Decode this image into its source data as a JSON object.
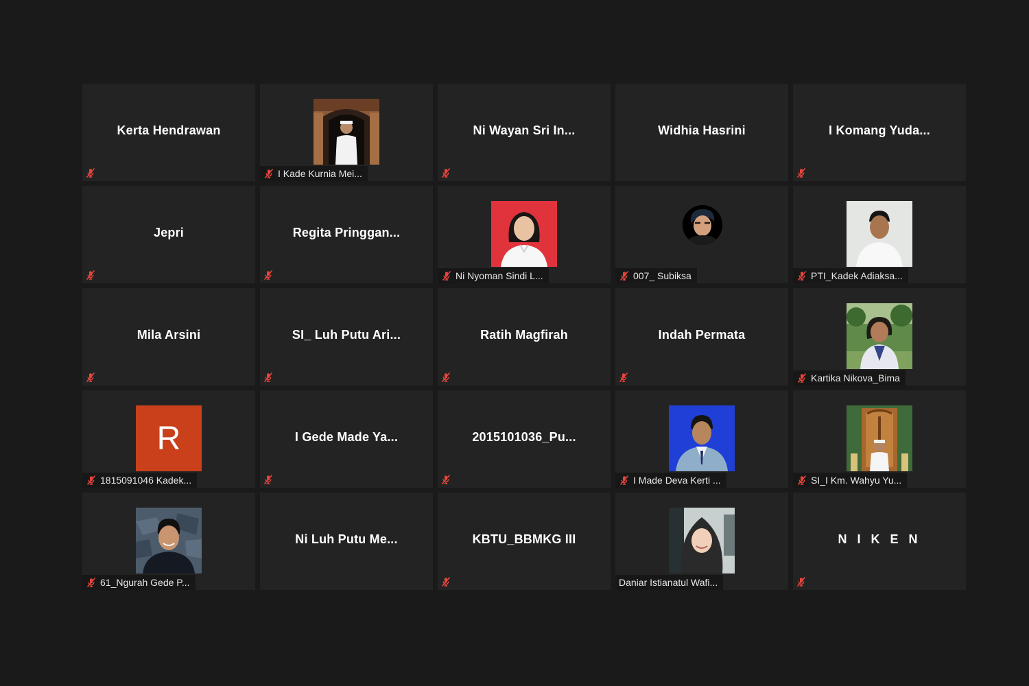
{
  "meeting": {
    "view": "gallery",
    "muted_icon": "microphone-muted-icon",
    "muted_color": "#e8453c",
    "tile_background": "#232323"
  },
  "participants": [
    {
      "display_name": "Kerta Hendrawan",
      "muted": true
    },
    {
      "video_label": "I Kade Kurnia Mei...",
      "muted": true,
      "image": "photo-man-temple-gate"
    },
    {
      "display_name": "Ni Wayan Sri In...",
      "muted": true
    },
    {
      "display_name": "Widhia Hasrini",
      "muted": false
    },
    {
      "display_name": "I Komang Yuda...",
      "muted": true
    },
    {
      "display_name": "Jepri",
      "muted": true
    },
    {
      "display_name": "Regita  Pringgan...",
      "muted": true
    },
    {
      "video_label": "Ni Nyoman Sindi L...",
      "muted": true,
      "image": "photo-woman-red-background"
    },
    {
      "video_label": "007_ Subiksa",
      "muted": true,
      "image": "avatar-man-round"
    },
    {
      "video_label": "PTI_Kadek Adiaksa...",
      "muted": true,
      "image": "photo-man-white-background"
    },
    {
      "display_name": "Mila Arsini",
      "muted": true
    },
    {
      "display_name": "SI_ Luh Putu Ari...",
      "muted": true
    },
    {
      "display_name": "Ratih Magfirah",
      "muted": true
    },
    {
      "display_name": "Indah Permata",
      "muted": true
    },
    {
      "video_label": "Kartika Nikova_Bima",
      "muted": true,
      "image": "photo-woman-outdoor-trees"
    },
    {
      "video_label": "1815091046 Kadek...",
      "muted": true,
      "initial": "R",
      "initial_color": "#c9401b"
    },
    {
      "display_name": "I Gede Made Ya...",
      "muted": true
    },
    {
      "display_name": "2015101036_Pu...",
      "muted": true
    },
    {
      "video_label": "I Made Deva Kerti ...",
      "muted": true,
      "image": "photo-man-blue-background"
    },
    {
      "video_label": "SI_I Km. Wahyu Yu...",
      "muted": true,
      "image": "photo-man-carved-door"
    },
    {
      "video_label": "61_Ngurah Gede P...",
      "muted": true,
      "image": "photo-man-stone-wall"
    },
    {
      "display_name": "Ni Luh Putu Me...",
      "muted": false
    },
    {
      "display_name": "KBTU_BBMKG III",
      "muted": true
    },
    {
      "video_label": "Daniar Istianatul Wafi...",
      "muted": false,
      "image": "photo-woman-hijab"
    },
    {
      "display_name": "N I K E N",
      "muted": true
    }
  ]
}
